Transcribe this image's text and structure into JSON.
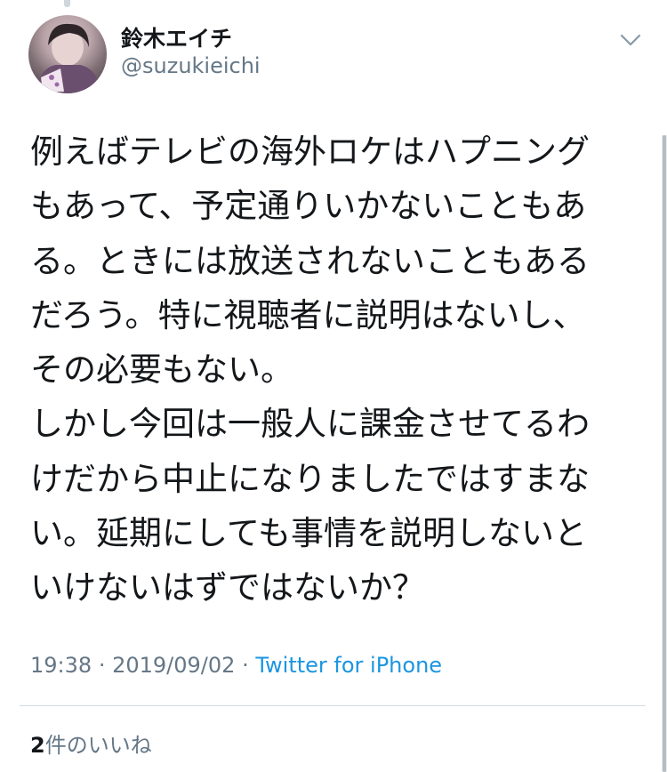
{
  "author": {
    "display_name": "鈴木エイチ",
    "handle": "@suzukieichi"
  },
  "icons": {
    "menu": "chevron-down-icon"
  },
  "tweet": {
    "lines": [
      "例えばテレビの海外ロケはハプニング",
      "もあって、予定通りいかないこともあ",
      "る。ときには放送されないこともある",
      "だろう。特に視聴者に説明はないし、",
      "その必要もない。",
      "しかし今回は一般人に課金させてるわ",
      "けだから中止になりましたではすまな",
      "い。延期にしても事情を説明しないと",
      "いけないはずではないか？"
    ],
    "time": "19:38",
    "date": "2019/09/02",
    "separator": "·",
    "source": "Twitter for iPhone"
  },
  "likes": {
    "count": "2",
    "label": "件のいいね"
  },
  "colors": {
    "text": "#14171a",
    "secondary": "#657786",
    "link": "#1b95e0",
    "divider": "#d4dbe1"
  }
}
